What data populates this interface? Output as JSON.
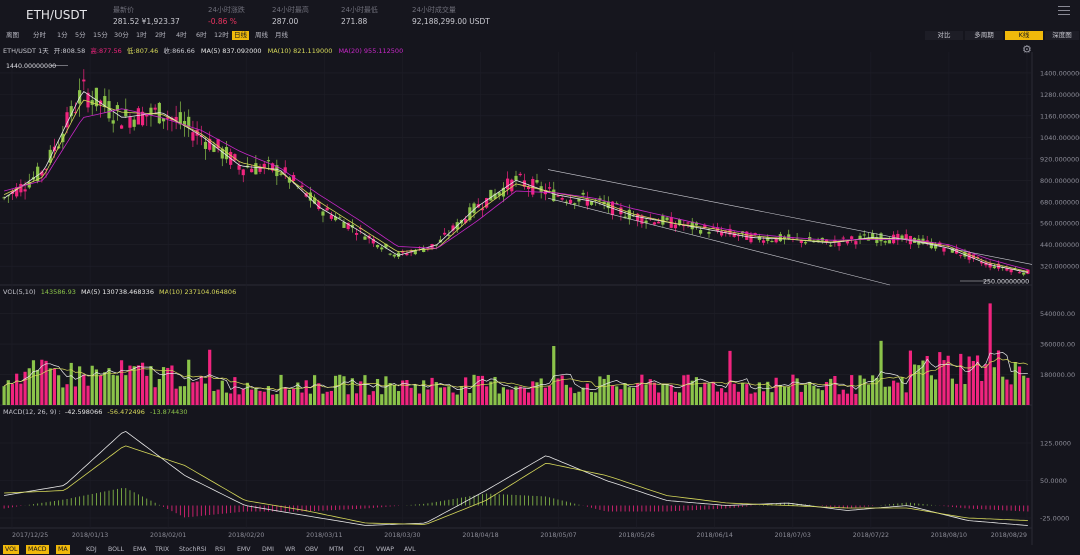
{
  "header": {
    "pair": "ETH/USDT",
    "stats": [
      {
        "label": "最新价",
        "value": "281.52 ¥1,923.37",
        "accent": false
      },
      {
        "label": "24小时涨跌",
        "value": "-0.86 %",
        "accent": true
      },
      {
        "label": "24小时最高",
        "value": "287.00",
        "accent": false
      },
      {
        "label": "24小时最低",
        "value": "271.88",
        "accent": false
      },
      {
        "label": "24小时成交量",
        "value": "92,188,299.00 USDT",
        "accent": false
      }
    ]
  },
  "toolbar": {
    "intervals": [
      "离图",
      "分时",
      "1分",
      "5分",
      "15分",
      "30分",
      "1时",
      "2时",
      "4时",
      "6时",
      "12时",
      "日线",
      "周线",
      "月线"
    ],
    "active_interval": "日线",
    "views": [
      "对比",
      "多周期",
      "K线",
      "深度图"
    ],
    "active_view": "K线"
  },
  "legend": {
    "symbol": "ETH/USDT 1天",
    "open_label": "开:",
    "open": "808.58",
    "high_label": "高:",
    "high": "877.56",
    "low_label": "低:",
    "low": "807.46",
    "close_label": "收:",
    "close": "866.66",
    "ma5": "MA(5) 837.092000",
    "ma10": "MA(10) 821.119000",
    "ma20": "MA(20) 955.112500"
  },
  "vol_legend": {
    "title": "VOL(5,10)",
    "vol": "143586.93",
    "ma5": "MA(5) 130738.468336",
    "ma10": "MA(10) 237104.064806"
  },
  "macd_legend": {
    "title": "MACD(12, 26, 9) :",
    "dif": "-42.598066",
    "dea": "-56.472496",
    "hist": "-13.874430"
  },
  "indicators": [
    "VOL",
    "MACD",
    "MA",
    "KDJ",
    "BOLL",
    "EMA",
    "TRIX",
    "StochRSI",
    "RSI",
    "EMV",
    "DMI",
    "WR",
    "OBV",
    "MTM",
    "CCI",
    "VWAP",
    "AVL"
  ],
  "active_indicators": [
    "VOL",
    "MACD",
    "MA"
  ],
  "colors": {
    "up": "#8bc34a",
    "down": "#f0247e",
    "ma5": "#e8e8e8",
    "ma10": "#d6d85a",
    "ma20": "#c727c7",
    "accent": "#f0b90b",
    "bg": "#15151d"
  },
  "chart_data": {
    "type": "line",
    "title": "ETH/USDT 1天",
    "x_ticks": [
      "2017/12/25",
      "2018/01/13",
      "2018/02/01",
      "2018/02/20",
      "2018/03/11",
      "2018/03/30",
      "2018/04/18",
      "2018/05/07",
      "2018/05/26",
      "2018/06/14",
      "2018/07/03",
      "2018/07/22",
      "2018/08/10",
      "2018/08/29"
    ],
    "price_axis": [
      "1400.000000",
      "1280.000000",
      "1160.000000",
      "1040.000000",
      "920.000000",
      "800.000000",
      "680.000000",
      "560.000000",
      "440.000000",
      "320.000000"
    ],
    "price_range": [
      215,
      1500
    ],
    "price_high_marker": "1440.00000000",
    "price_low_marker": "250.00000000",
    "volume_axis": [
      "540000.00",
      "360000.00",
      "180000.00"
    ],
    "volume_range": [
      0,
      620000
    ],
    "macd_axis": [
      "125.0000",
      "50.0000",
      "-25.0000"
    ],
    "macd_range": [
      -45,
      175
    ],
    "series": [
      {
        "name": "MA(5)",
        "values": [
          700,
          850,
          1300,
          1150,
          1180,
          1050,
          880,
          860,
          650,
          520,
          380,
          440,
          650,
          800,
          720,
          680,
          600,
          560,
          520,
          480,
          470,
          450,
          480,
          470,
          420,
          330,
          285
        ]
      },
      {
        "name": "MA(10)",
        "values": [
          720,
          820,
          1250,
          1180,
          1170,
          1060,
          900,
          850,
          680,
          540,
          400,
          420,
          620,
          780,
          730,
          690,
          610,
          560,
          530,
          490,
          470,
          455,
          475,
          470,
          430,
          340,
          290
        ]
      },
      {
        "name": "MA(20)",
        "values": [
          740,
          800,
          1150,
          1200,
          1150,
          1080,
          960,
          870,
          720,
          580,
          430,
          420,
          570,
          740,
          730,
          700,
          640,
          590,
          540,
          500,
          480,
          465,
          470,
          470,
          440,
          360,
          300
        ]
      }
    ]
  }
}
